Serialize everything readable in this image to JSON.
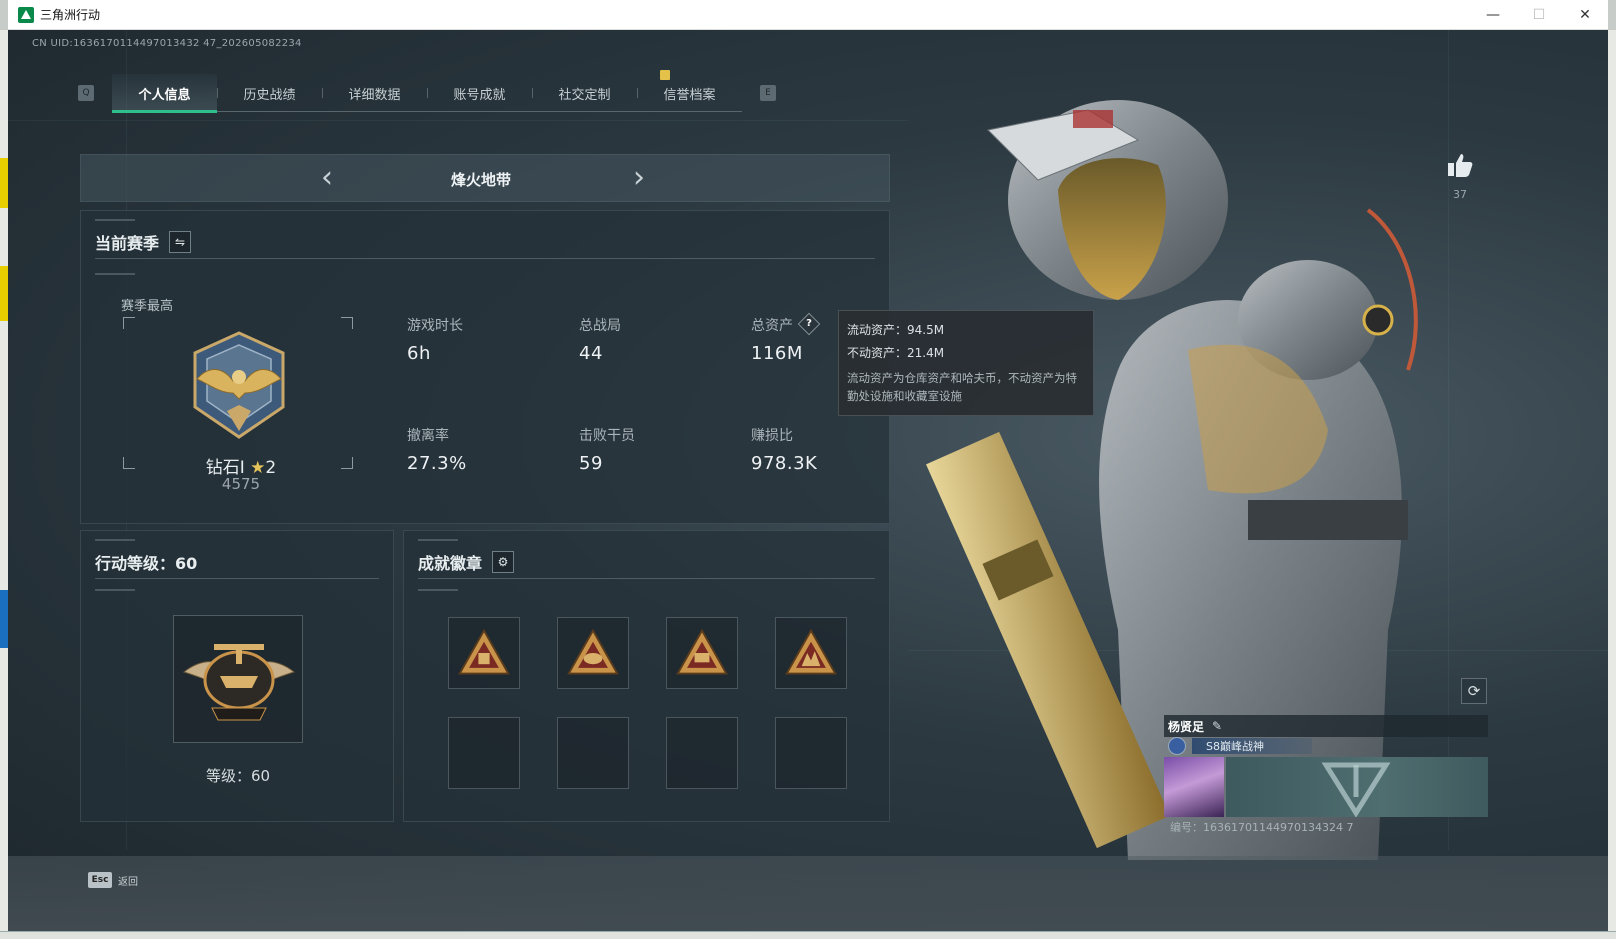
{
  "window": {
    "title": "三角洲行动",
    "minimize": "—",
    "maximize": "☐",
    "close": "✕"
  },
  "uid_line": "CN UID:1636170114497013432 47_202605082234",
  "tabs": {
    "left_key": "Q",
    "right_key": "E",
    "items": [
      {
        "label": "个人信息",
        "active": true
      },
      {
        "label": "历史战绩",
        "active": false
      },
      {
        "label": "详细数据",
        "active": false
      },
      {
        "label": "账号成就",
        "active": false
      },
      {
        "label": "社交定制",
        "active": false
      },
      {
        "label": "信誉档案",
        "active": false
      }
    ]
  },
  "mode": {
    "title": "烽火地带",
    "prev": "‹",
    "next": "›"
  },
  "season": {
    "title": "当前赛季",
    "switch_icon": "⇋",
    "best_label": "赛季最高",
    "rank_name": "钻石I",
    "rank_star": "★",
    "rank_stars": "2",
    "rank_score": "4575",
    "stats": [
      {
        "label": "游戏时长",
        "value": "6h"
      },
      {
        "label": "总战局",
        "value": "44"
      },
      {
        "label": "总资产",
        "value": "116M"
      },
      {
        "label": "撤离率",
        "value": "27.3%"
      },
      {
        "label": "击败干员",
        "value": "59"
      },
      {
        "label": "赚损比",
        "value": "978.3K"
      }
    ],
    "help": "?"
  },
  "tooltip": {
    "liquid": "流动资产：94.5M",
    "fixed": "不动资产：21.4M",
    "desc": "流动资产为仓库资产和哈夫币，不动资产为特勤处设施和收藏室设施"
  },
  "level": {
    "title": "行动等级：60",
    "text": "等级：60"
  },
  "badges": {
    "title": "成就徽章",
    "settings_icon": "⚙",
    "filled_count": 4,
    "empty_count": 4,
    "badge_colors": [
      "#c9944a",
      "#c9944a",
      "#c9944a",
      "#c9944a"
    ]
  },
  "likes": {
    "count": "37"
  },
  "player": {
    "name": "杨贤足",
    "title": "S8巅峰战神",
    "uid": "编号：16361701144970134324 7"
  },
  "footer": {
    "esc_key": "Esc",
    "esc_label": "返回"
  },
  "colors": {
    "accent": "#2fbf8c",
    "gold": "#c9944a",
    "star": "#e3c35a"
  }
}
